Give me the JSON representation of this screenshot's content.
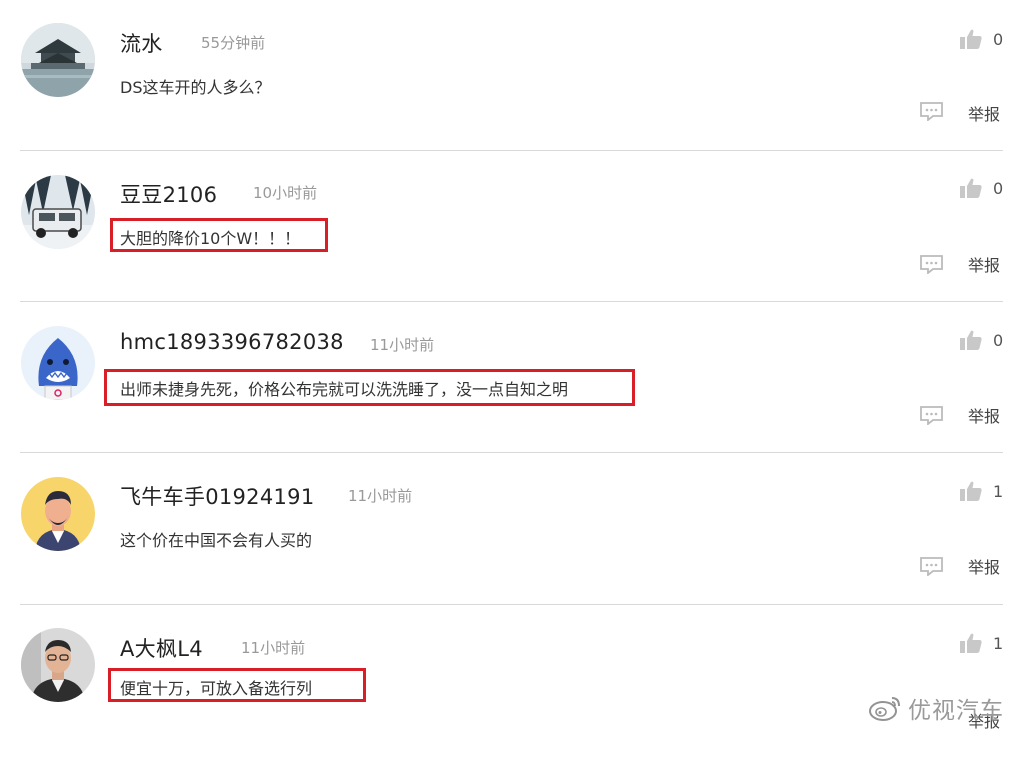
{
  "comments": [
    {
      "username": "流水",
      "time": "55分钟前",
      "content": "DS这车开的人多么？",
      "likes": "0",
      "report": "举报",
      "highlighted": false
    },
    {
      "username": "豆豆2106",
      "time": "10小时前",
      "content": "大胆的降价10个W！！！",
      "likes": "0",
      "report": "举报",
      "highlighted": true
    },
    {
      "username": "hmc1893396782038",
      "time": "11小时前",
      "content": "出师未捷身先死，价格公布完就可以洗洗睡了，没一点自知之明",
      "likes": "0",
      "report": "举报",
      "highlighted": true
    },
    {
      "username": "飞牛车手01924191",
      "time": "11小时前",
      "content": "这个价在中国不会有人买的",
      "likes": "1",
      "report": "举报",
      "highlighted": false
    },
    {
      "username": "A大枫L4",
      "time": "11小时前",
      "content": "便宜十万，可放入备选行列",
      "likes": "1",
      "report": "举报",
      "highlighted": true
    }
  ],
  "watermark": {
    "text": "优视汽车",
    "icon": "weibo-icon"
  },
  "colors": {
    "highlight": "#d81e27",
    "divider": "#d9d9d9",
    "muted": "#999999"
  }
}
